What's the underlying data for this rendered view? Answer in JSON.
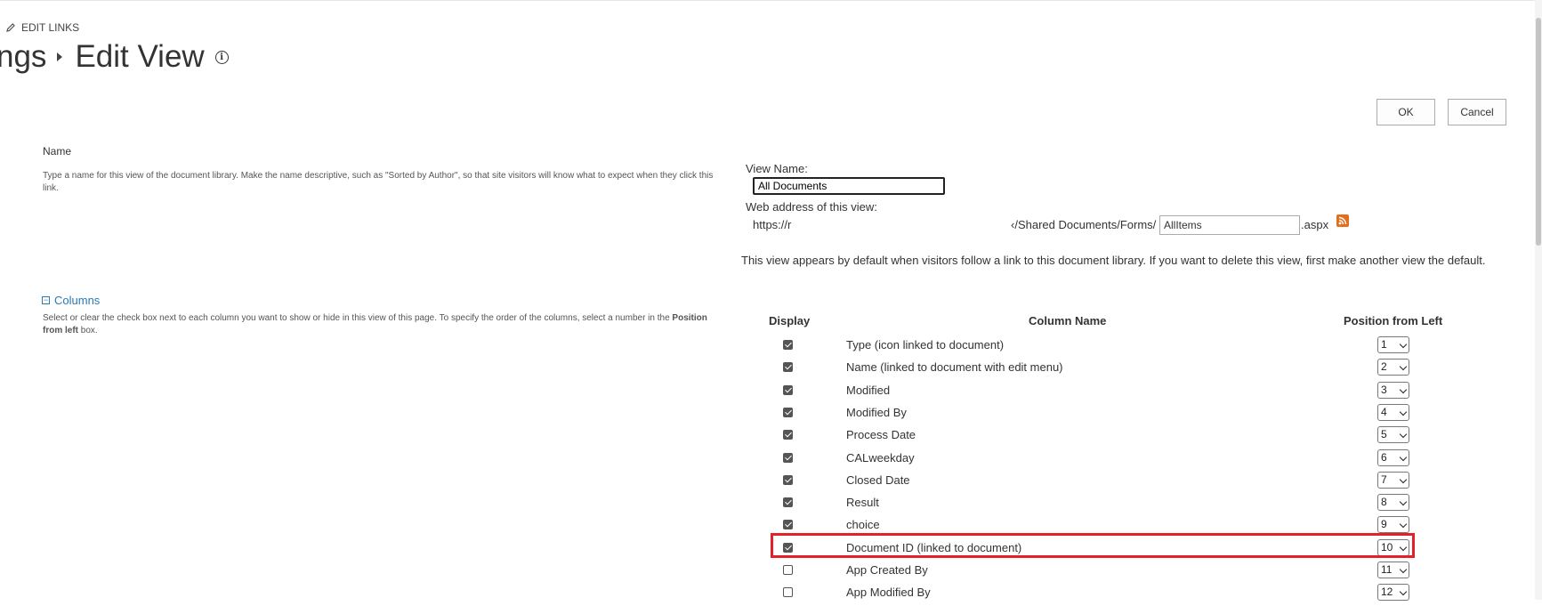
{
  "header": {
    "edit_links": "EDIT LINKS",
    "breadcrumb_parent": "ngs",
    "page_title": "Edit View"
  },
  "toolbar": {
    "ok_label": "OK",
    "cancel_label": "Cancel"
  },
  "name_section": {
    "heading": "Name",
    "description": "Type a name for this view of the document library. Make the name descriptive, such as \"Sorted by Author\", so that site visitors will know what to expect when they click this link.",
    "view_name_label": "View Name:",
    "view_name_value": "All Documents",
    "web_address_label": "Web address of this view:",
    "url_prefix": "https://r",
    "url_middle": "‹/Shared Documents/Forms/",
    "url_page_value": "AllItems",
    "url_suffix": ".aspx",
    "default_note": "This view appears by default when visitors follow a link to this document library. If you want to delete this view, first make another view the default."
  },
  "columns_section": {
    "heading": "Columns",
    "description_prefix": "Select or clear the check box next to each column you want to show or hide in this view of this page. To specify the order of the columns, select a number in the ",
    "description_bold": "Position from left",
    "description_suffix": " box.",
    "headers": {
      "display": "Display",
      "column_name": "Column Name",
      "position": "Position from Left"
    },
    "rows": [
      {
        "name": "Type (icon linked to document)",
        "checked": true,
        "position": "1"
      },
      {
        "name": "Name (linked to document with edit menu)",
        "checked": true,
        "position": "2"
      },
      {
        "name": "Modified",
        "checked": true,
        "position": "3"
      },
      {
        "name": "Modified By",
        "checked": true,
        "position": "4"
      },
      {
        "name": "Process Date",
        "checked": true,
        "position": "5"
      },
      {
        "name": "CALweekday",
        "checked": true,
        "position": "6"
      },
      {
        "name": "Closed Date",
        "checked": true,
        "position": "7"
      },
      {
        "name": "Result",
        "checked": true,
        "position": "8"
      },
      {
        "name": "choice",
        "checked": true,
        "position": "9"
      },
      {
        "name": "Document ID (linked to document)",
        "checked": true,
        "position": "10"
      },
      {
        "name": "App Created By",
        "checked": false,
        "position": "11"
      },
      {
        "name": "App Modified By",
        "checked": false,
        "position": "12"
      }
    ]
  },
  "colors": {
    "link": "#2a7ab3",
    "highlight": "#e5202a",
    "rss": "#e46e1c"
  },
  "icons": {
    "edit": "pencil-icon",
    "info": "info-icon",
    "rss": "rss-icon",
    "collapse": "collapse-icon"
  }
}
